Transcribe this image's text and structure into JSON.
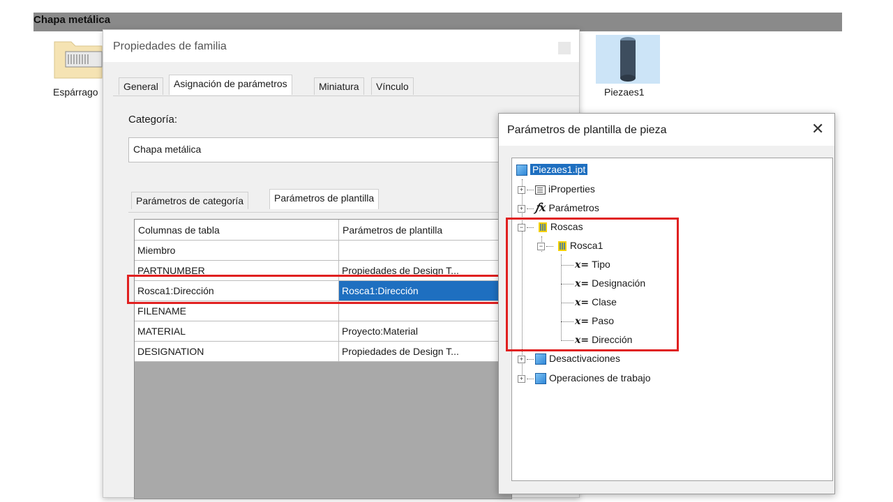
{
  "background_window": {
    "title": "Chapa metálica",
    "folder_item_label": "Espárrago",
    "part_item_label": "Piezaes1"
  },
  "family_dialog": {
    "title": "Propiedades de familia",
    "tabs": [
      "General",
      "Asignación de parámetros",
      "Miniatura",
      "Vínculo"
    ],
    "active_tab": "Asignación de parámetros",
    "category_label": "Categoría:",
    "category_value": "Chapa metálica",
    "sub_tabs": [
      "Parámetros de categoría",
      "Parámetros de plantilla"
    ],
    "active_sub_tab": "Parámetros de plantilla",
    "table": {
      "headers": [
        "Columnas de tabla",
        "Parámetros de plantilla"
      ],
      "rows": [
        [
          "Miembro",
          ""
        ],
        [
          "PARTNUMBER",
          "Propiedades de Design T..."
        ],
        [
          "Rosca1:Dirección",
          "Rosca1:Dirección"
        ],
        [
          "FILENAME",
          ""
        ],
        [
          "MATERIAL",
          "Proyecto:Material"
        ],
        [
          "DESIGNATION",
          "Propiedades de Design T..."
        ]
      ],
      "selected_row": 2
    }
  },
  "template_dialog": {
    "title": "Parámetros de plantilla de pieza",
    "close_glyph": "✕",
    "tree": {
      "root": "Piezaes1.ipt",
      "iproperties": "iProperties",
      "parametros": "Parámetros",
      "roscas": "Roscas",
      "rosca1": "Rosca1",
      "params": [
        "Tipo",
        "Designación",
        "Clase",
        "Paso",
        "Dirección"
      ],
      "desactivaciones": "Desactivaciones",
      "operaciones": "Operaciones de trabajo"
    }
  },
  "highlight_color": "#e02020"
}
